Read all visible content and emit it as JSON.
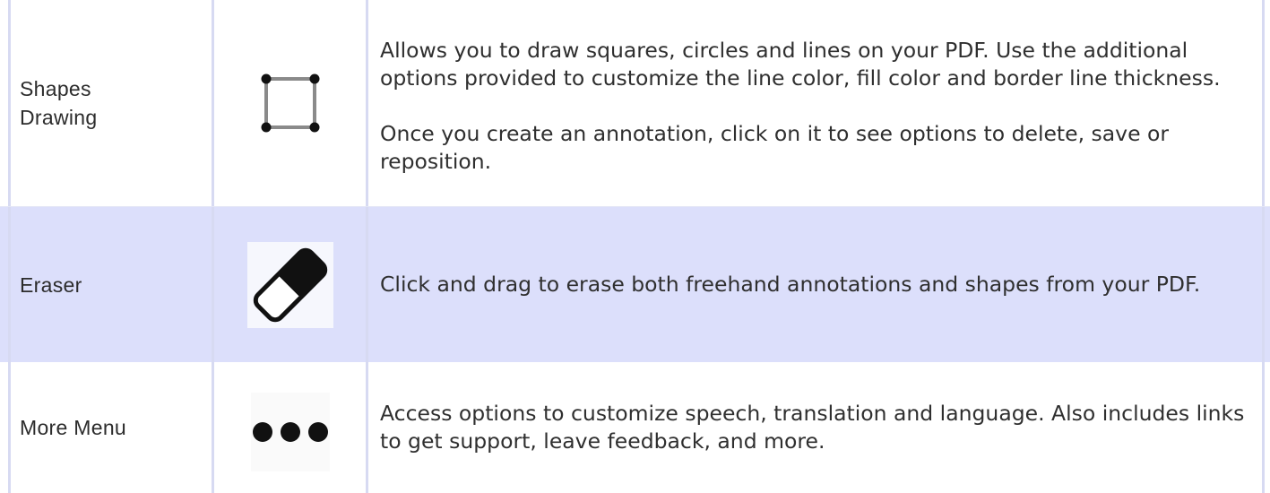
{
  "rows": [
    {
      "name": "Shapes\nDrawing",
      "icon": "rectangle-shape-icon",
      "description": [
        "Allows you to draw squares, circles and lines on your PDF. Use the additional options provided to customize the line color, fill color and border line thickness.",
        "Once you create an annotation, click on it to see options to delete, save or reposition."
      ]
    },
    {
      "name": "Eraser",
      "icon": "eraser-icon",
      "description": [
        "Click and drag to erase both freehand annotations and shapes from your PDF."
      ]
    },
    {
      "name": "More Menu",
      "icon": "more-dots-icon",
      "description": [
        "Access options to customize speech, translation and language. Also includes links to get support, leave feedback, and more."
      ]
    }
  ],
  "colors": {
    "highlight_row": "#dcdffb",
    "border": "#d7daf2",
    "text": "#2f2f2f",
    "icon": "#111111"
  }
}
